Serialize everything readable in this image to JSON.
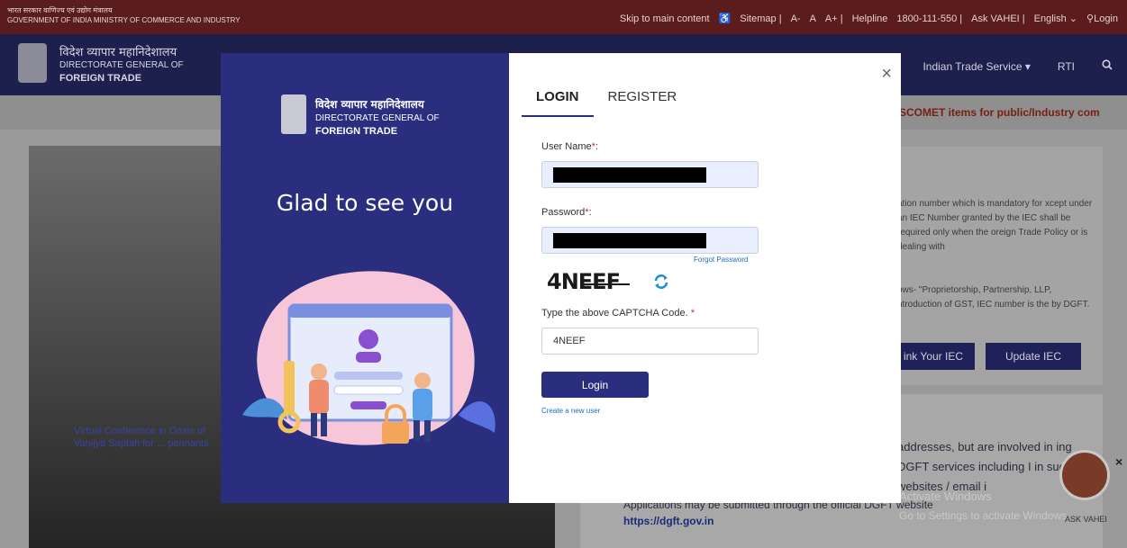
{
  "gov_strip": {
    "hindi": "भारत सरकार  वाणिज्य एवं उद्योग मंत्रालय",
    "english": "GOVERNMENT OF INDIA  MINISTRY OF COMMERCE AND INDUSTRY",
    "links": [
      "Skip to main content",
      "Sitemap |",
      "A-",
      "A",
      "A+ |",
      "Helpline",
      "1800-111-550 |",
      "Ask VAHEI |",
      "English ⌄",
      "Login"
    ]
  },
  "brand": {
    "hindi": "विदेश व्यापार महानिदेशालय",
    "line1": "DIRECTORATE GENERAL OF",
    "line2": "FOREIGN TRADE"
  },
  "nav": {
    "items": [
      "Indian Trade Service ▾",
      "RTI"
    ]
  },
  "ticker": "SCOMET items for public/Industry com",
  "background": {
    "caption": "Virtual Conference in Oasis of Vanijya Saptah for ... pennants",
    "card1_text": "ation number which is mandatory for xcept under an IEC Number granted by the IEC shall be required only when the oreign Trade Policy or is dealing with",
    "card1_text2": "ows- \"Proprietorship, Partnership, LLP, ntroduction of GST, IEC number is the by DGFT.",
    "btn_link": "ink Your IEC",
    "btn_update": "Update IEC",
    "card2_text": "addresses, but are involved in ing DGFT services including I in such websites / email i",
    "card2_line": "Applications may be submitted through the official DGFT website",
    "card2_link": "https://dgft.gov.in",
    "watermark1": "Activate Windows",
    "watermark2": "Go to Settings to activate Windows.",
    "ask_vahei": "ASK VAHEI"
  },
  "modal": {
    "brand_hindi": "विदेश व्यापार महानिदेशालय",
    "brand_line1": "DIRECTORATE GENERAL OF",
    "brand_line2": "FOREIGN TRADE",
    "greeting": "Glad to see you",
    "tabs": [
      "LOGIN",
      "REGISTER"
    ],
    "username_label": "User Name",
    "password_label": "Password",
    "forgot": "Forgot Password",
    "captcha_text": "4NEEF",
    "captcha_label": "Type the above CAPTCHA Code.",
    "captcha_value": "4NEEF",
    "login_button": "Login",
    "create_link": "Create a new user",
    "close": "×"
  },
  "colors": {
    "modal_primary": "#2b2e7f",
    "link": "#1a6fc0",
    "required": "#d62828"
  }
}
